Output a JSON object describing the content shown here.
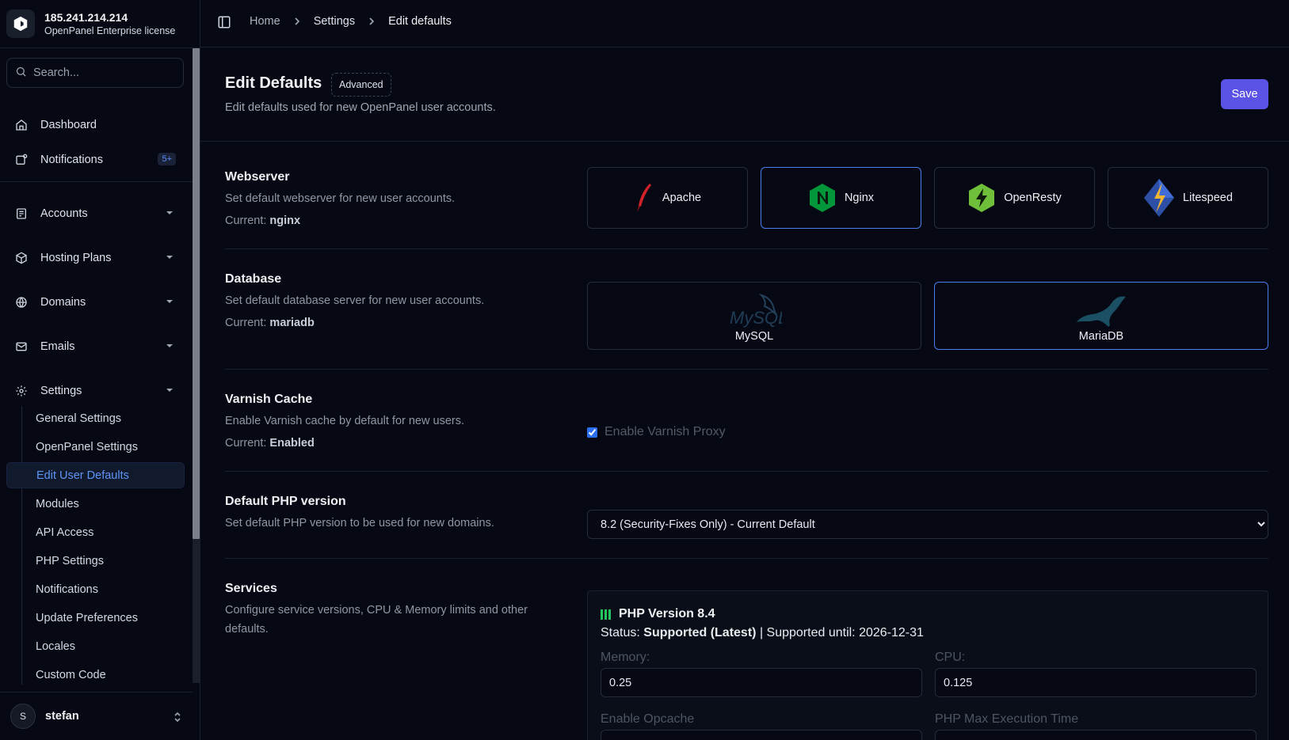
{
  "brand": {
    "ip": "185.241.214.214",
    "license": "OpenPanel Enterprise license"
  },
  "search": {
    "placeholder": "Search..."
  },
  "nav": {
    "dashboard": "Dashboard",
    "notifications": "Notifications",
    "notifications_badge": "5+",
    "accounts": "Accounts",
    "hosting_plans": "Hosting Plans",
    "domains": "Domains",
    "emails": "Emails",
    "settings": "Settings"
  },
  "settings_sub": [
    "General Settings",
    "OpenPanel Settings",
    "Edit User Defaults",
    "Modules",
    "API Access",
    "PHP Settings",
    "Notifications",
    "Update Preferences",
    "Locales",
    "Custom Code"
  ],
  "user": {
    "initial": "S",
    "name": "stefan"
  },
  "breadcrumb": [
    "Home",
    "Settings",
    "Edit defaults"
  ],
  "header": {
    "title": "Edit Defaults",
    "badge": "Advanced",
    "subtitle": "Edit defaults used for new OpenPanel user accounts.",
    "save_label": "Save"
  },
  "webserver": {
    "title": "Webserver",
    "desc": "Set default webserver for new user accounts.",
    "current_label": "Current:",
    "current_value": "nginx",
    "options": [
      "Apache",
      "Nginx",
      "OpenResty",
      "Litespeed"
    ],
    "selected": "Nginx"
  },
  "database": {
    "title": "Database",
    "desc": "Set default database server for new user accounts.",
    "current_label": "Current:",
    "current_value": "mariadb",
    "options": [
      "MySQL",
      "MariaDB"
    ],
    "selected": "MariaDB",
    "mysql_logo_text": "MySQL"
  },
  "varnish": {
    "title": "Varnish Cache",
    "desc": "Enable Varnish cache by default for new users.",
    "current_label": "Current:",
    "current_value": "Enabled",
    "checkbox_label": "Enable Varnish Proxy",
    "checked": true
  },
  "php": {
    "title": "Default PHP version",
    "desc": "Set default PHP version to be used for new domains.",
    "selected": "8.2 (Security-Fixes Only) - Current Default"
  },
  "services": {
    "title": "Services",
    "desc": "Configure service versions, CPU & Memory limits and other defaults.",
    "php_version_title": "PHP Version 8.4",
    "status_label": "Status:",
    "status_value": "Supported (Latest)",
    "supported_until": "| Supported until: 2026-12-31",
    "memory_label": "Memory:",
    "memory_value": "0.25",
    "cpu_label": "CPU:",
    "cpu_value": "0.125",
    "opcache_label": "Enable Opcache",
    "max_exec_label": "PHP Max Execution Time"
  },
  "colors": {
    "accent": "#5b53e6",
    "selected_border": "#4c7cf2",
    "active_nav": "#5e95f5",
    "background": "#060913"
  }
}
